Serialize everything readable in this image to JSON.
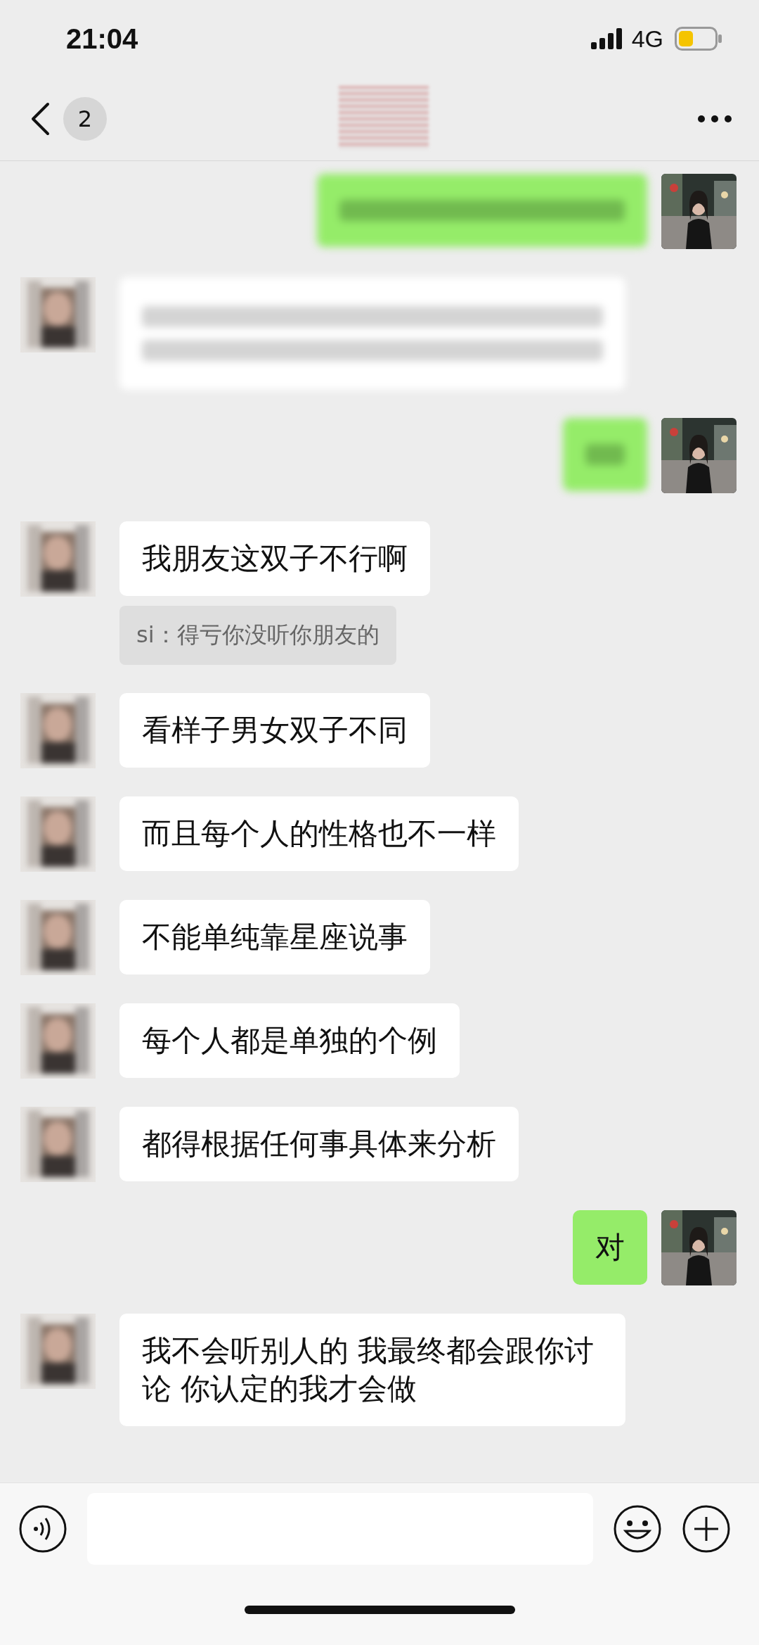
{
  "status_bar": {
    "time": "21:04",
    "network": "4G"
  },
  "header": {
    "unread_count": "2"
  },
  "messages": [
    {
      "outgoing": true,
      "blurred": true,
      "two_lines": false,
      "short": false
    },
    {
      "outgoing": false,
      "blurred": true,
      "two_lines": true,
      "short": false
    },
    {
      "outgoing": true,
      "blurred": true,
      "two_lines": false,
      "short": true
    },
    {
      "outgoing": false,
      "text": "我朋友这双子不行啊",
      "quote": "si：得亏你没听你朋友的"
    },
    {
      "outgoing": false,
      "text": "看样子男女双子不同"
    },
    {
      "outgoing": false,
      "text": "而且每个人的性格也不一样"
    },
    {
      "outgoing": false,
      "text": "不能单纯靠星座说事"
    },
    {
      "outgoing": false,
      "text": "每个人都是单独的个例"
    },
    {
      "outgoing": false,
      "text": "都得根据任何事具体来分析"
    },
    {
      "outgoing": true,
      "text": "对"
    },
    {
      "outgoing": false,
      "text": "我不会听别人的 我最终都会跟你讨论 你认定的我才会做"
    }
  ]
}
